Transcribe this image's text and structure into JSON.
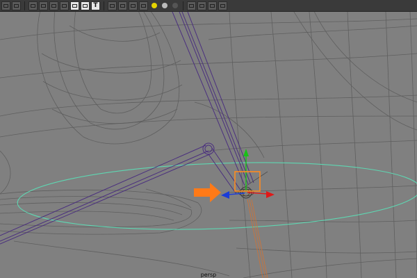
{
  "toolbar": {
    "groups": [
      [
        {
          "name": "camera-attributes-icon"
        },
        {
          "name": "camera-icon"
        }
      ],
      [
        {
          "name": "grid-toggle-icon"
        },
        {
          "name": "isolate-select-icon"
        },
        {
          "name": "wireframe-on-shaded-icon"
        },
        {
          "name": "xray-icon"
        },
        {
          "name": "smooth-shade-icon",
          "on": true
        },
        {
          "name": "use-all-lights-icon",
          "on": true
        },
        {
          "name": "texture-text-icon",
          "glyph": "T",
          "on": true
        }
      ],
      [
        {
          "name": "wireframe-cube-icon"
        },
        {
          "name": "shaded-cube-icon"
        },
        {
          "name": "bounding-box-icon"
        },
        {
          "name": "checker-icon"
        },
        {
          "name": "yellow-light-icon",
          "color": "#e5d300"
        },
        {
          "name": "default-light-icon",
          "color": "#bbbbbb"
        },
        {
          "name": "shadow-light-icon",
          "color": "#555555"
        }
      ],
      [
        {
          "name": "xray-joints-icon"
        },
        {
          "name": "resolution-gate-icon"
        },
        {
          "name": "film-gate-icon"
        },
        {
          "name": "share-icon"
        }
      ]
    ]
  },
  "viewport": {
    "camera_label": "persp",
    "colors": {
      "background": "#808080",
      "wireframe": "#5b5b5b",
      "bone": "#4a2f7e",
      "nurbs_curve": "#5ed7b2",
      "selection_box": "#ff8a1f",
      "arrow": "#ff7a18",
      "axis_x": "#e01818",
      "axis_y": "#18c018",
      "axis_z": "#1a3cd8",
      "chain": "#c8743c"
    }
  }
}
